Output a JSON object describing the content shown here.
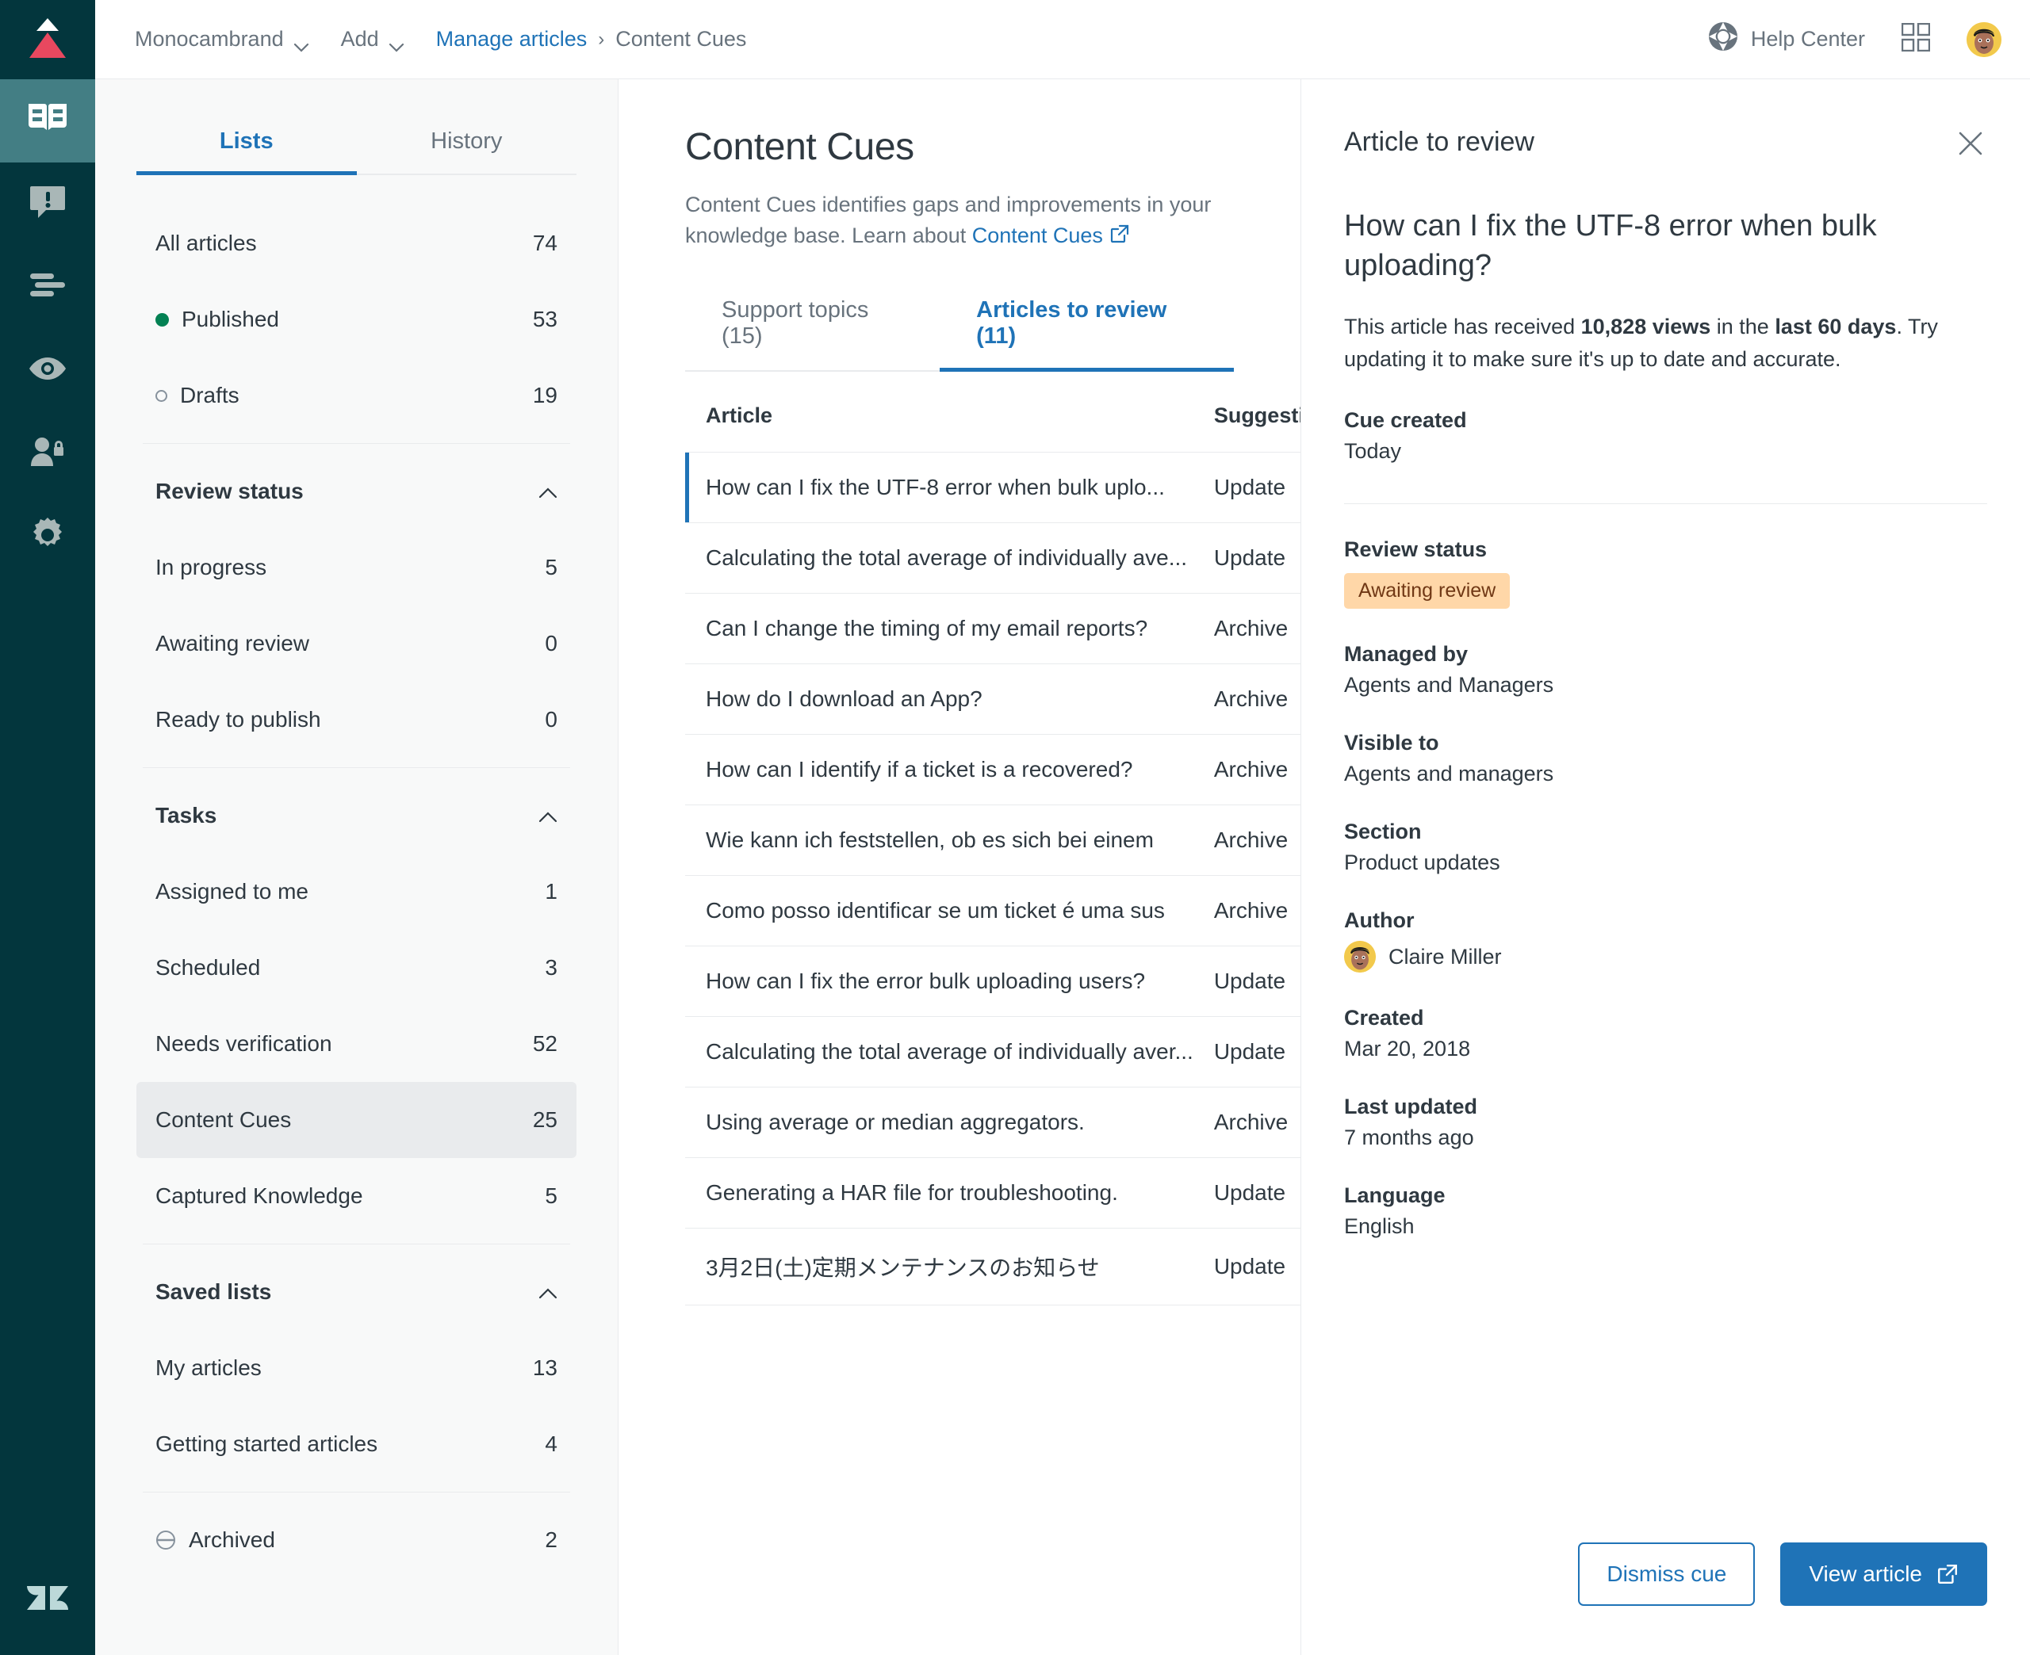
{
  "topbar": {
    "brand_menu": "Monocambrand",
    "add_menu": "Add",
    "breadcrumb_link": "Manage articles",
    "breadcrumb_sep": "›",
    "breadcrumb_current": "Content Cues",
    "help_center": "Help Center"
  },
  "rail": {
    "items": [
      {
        "name": "knowledge-base",
        "icon": "book-icon",
        "active": true
      },
      {
        "name": "alerts",
        "icon": "alert-speech-bubble-icon",
        "active": false
      },
      {
        "name": "lists",
        "icon": "list-lines-icon",
        "active": false
      },
      {
        "name": "views",
        "icon": "eye-icon",
        "active": false
      },
      {
        "name": "permissions",
        "icon": "user-lock-icon",
        "active": false
      },
      {
        "name": "settings",
        "icon": "gear-icon",
        "active": false
      }
    ],
    "footer_logo": "zendesk-logo"
  },
  "lists_pane": {
    "tabs": [
      {
        "label": "Lists",
        "active": true
      },
      {
        "label": "History",
        "active": false
      }
    ],
    "top_items": [
      {
        "label": "All articles",
        "count": "74",
        "marker": "none",
        "selected": false
      },
      {
        "label": "Published",
        "count": "53",
        "marker": "filled",
        "selected": false
      },
      {
        "label": "Drafts",
        "count": "19",
        "marker": "hollow",
        "selected": false
      }
    ],
    "sections": [
      {
        "title": "Review status",
        "collapsed": false,
        "items": [
          {
            "label": "In progress",
            "count": "5",
            "selected": false
          },
          {
            "label": "Awaiting review",
            "count": "0",
            "selected": false
          },
          {
            "label": "Ready to publish",
            "count": "0",
            "selected": false
          }
        ]
      },
      {
        "title": "Tasks",
        "collapsed": false,
        "items": [
          {
            "label": "Assigned to me",
            "count": "1",
            "selected": false
          },
          {
            "label": "Scheduled",
            "count": "3",
            "selected": false
          },
          {
            "label": "Needs verification",
            "count": "52",
            "selected": false
          },
          {
            "label": "Content Cues",
            "count": "25",
            "selected": true
          },
          {
            "label": "Captured Knowledge",
            "count": "5",
            "selected": false
          }
        ]
      },
      {
        "title": "Saved lists",
        "collapsed": false,
        "items": [
          {
            "label": "My articles",
            "count": "13",
            "selected": false
          },
          {
            "label": "Getting started articles",
            "count": "4",
            "selected": false
          }
        ]
      }
    ],
    "archived": {
      "label": "Archived",
      "count": "2",
      "icon": "archive-circle-icon"
    }
  },
  "main": {
    "title": "Content Cues",
    "description_before": "Content Cues identifies gaps and improvements in your knowledge base. Learn about ",
    "description_link": "Content Cues",
    "tabs": [
      {
        "label": "Support topics (15)",
        "active": false
      },
      {
        "label": "Articles to review (11)",
        "active": true
      }
    ],
    "columns": {
      "article": "Article",
      "suggestion": "Suggestion"
    },
    "rows": [
      {
        "article": "How can I fix the UTF-8 error when bulk uplo...",
        "suggestion": "Update",
        "selected": true
      },
      {
        "article": "Calculating the total average of individually ave...",
        "suggestion": "Update",
        "selected": false
      },
      {
        "article": "Can I change the timing of my email reports?",
        "suggestion": "Archive",
        "selected": false
      },
      {
        "article": "How do I download an App?",
        "suggestion": "Archive",
        "selected": false
      },
      {
        "article": "How can I identify if a ticket is a recovered?",
        "suggestion": "Archive",
        "selected": false
      },
      {
        "article": "Wie kann ich feststellen, ob es sich bei einem",
        "suggestion": "Archive",
        "selected": false
      },
      {
        "article": "Como posso identificar se um ticket é uma sus",
        "suggestion": "Archive",
        "selected": false
      },
      {
        "article": "How can I fix the error bulk uploading users?",
        "suggestion": "Update",
        "selected": false
      },
      {
        "article": "Calculating the total average of individually aver...",
        "suggestion": "Update",
        "selected": false
      },
      {
        "article": "Using average or median aggregators.",
        "suggestion": "Archive",
        "selected": false
      },
      {
        "article": "Generating a HAR file for troubleshooting.",
        "suggestion": "Update",
        "selected": false
      },
      {
        "article": "3月2日(土)定期メンテナンスのお知らせ",
        "suggestion": "Update",
        "selected": false
      }
    ]
  },
  "side": {
    "header": "Article to review",
    "article_title": "How can I fix the UTF-8 error when bulk uploading?",
    "summary_p1": "This article has received ",
    "summary_views": "10,828 views",
    "summary_p2": " in the ",
    "summary_days": "last 60 days",
    "summary_p3": ". Try updating it to make sure it's up to date and accurate.",
    "meta": [
      {
        "label": "Cue created",
        "value": "Today",
        "type": "text"
      },
      {
        "label": "Review status",
        "value": "Awaiting review",
        "type": "badge"
      },
      {
        "label": "Managed by",
        "value": "Agents and Managers",
        "type": "text"
      },
      {
        "label": "Visible to",
        "value": "Agents and managers",
        "type": "text"
      },
      {
        "label": "Section",
        "value": "Product updates",
        "type": "text"
      },
      {
        "label": "Author",
        "value": "Claire Miller",
        "type": "author"
      },
      {
        "label": "Created",
        "value": "Mar 20, 2018",
        "type": "text"
      },
      {
        "label": "Last updated",
        "value": "7 months ago",
        "type": "text"
      },
      {
        "label": "Language",
        "value": "English",
        "type": "text"
      }
    ],
    "dismiss_label": "Dismiss cue",
    "view_label": "View article"
  },
  "colors": {
    "rail_bg": "#03363D",
    "rail_active": "#437E84",
    "accent_blue": "#1f73b7",
    "published_green": "#038153",
    "badge_bg": "#FFD7A8",
    "badge_fg": "#703815",
    "brand_red": "#E8485F"
  }
}
